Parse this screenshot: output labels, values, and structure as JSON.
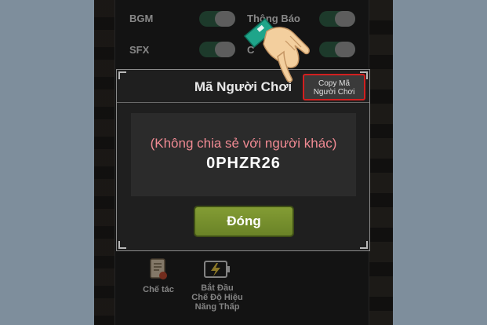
{
  "settings": {
    "bgm_label": "BGM",
    "sfx_label": "SFX",
    "notification_label": "Thông Báo",
    "partial_label": "C"
  },
  "dialog": {
    "title": "Mã Người Chơi",
    "copy_button_line1": "Copy Mã",
    "copy_button_line2": "Người Chơi",
    "note": "(Không chia sẻ với người khác)",
    "player_code": "0PHZR26",
    "close_button": "Đóng"
  },
  "bottom_menu": {
    "craft_label": "Chế tác",
    "low_power_line1": "Bắt Đầu",
    "low_power_line2": "Chế Độ Hiệu",
    "low_power_line3": "Năng Thấp"
  },
  "colors": {
    "highlight_border": "#d21f1f",
    "close_button": "#7a922f",
    "note_text": "#f08a93",
    "toggle_on": "#2d5a43"
  },
  "icons": [
    "scroll-icon",
    "battery-icon",
    "pointing-hand-icon"
  ]
}
